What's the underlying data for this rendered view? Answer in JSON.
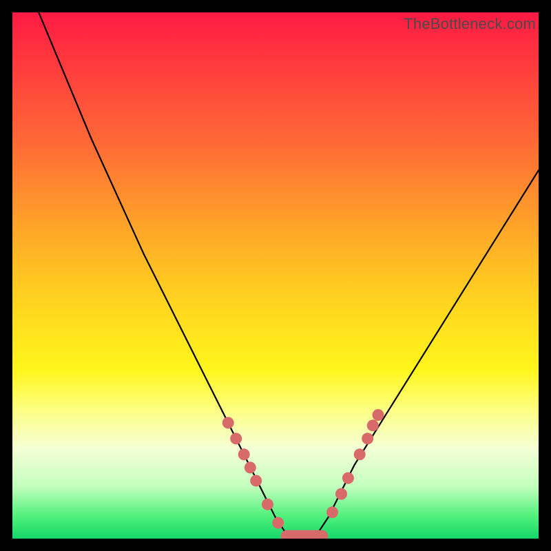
{
  "watermark": "TheBottleneck.com",
  "chart_data": {
    "type": "line",
    "title": "",
    "xlabel": "",
    "ylabel": "",
    "xlim": [
      0,
      100
    ],
    "ylim": [
      0,
      100
    ],
    "series": [
      {
        "name": "bottleneck-curve",
        "x": [
          5,
          10,
          15,
          20,
          25,
          30,
          35,
          40,
          42,
          44,
          46,
          48,
          50,
          52,
          54,
          56,
          58,
          60,
          62,
          65,
          70,
          75,
          80,
          85,
          90,
          95,
          100
        ],
        "values": [
          100,
          88,
          76,
          65,
          54,
          44,
          34,
          24,
          20,
          16,
          12,
          8,
          4,
          1,
          0,
          0,
          1,
          4,
          8,
          14,
          22,
          30,
          38,
          46,
          54,
          62,
          70
        ]
      }
    ],
    "markers": {
      "name": "highlight-dots",
      "color": "#d86a6a",
      "points": [
        {
          "x": 41.0,
          "y": 22
        },
        {
          "x": 42.5,
          "y": 19
        },
        {
          "x": 44.0,
          "y": 16
        },
        {
          "x": 45.2,
          "y": 13.5
        },
        {
          "x": 46.3,
          "y": 11
        },
        {
          "x": 48.5,
          "y": 6.5
        },
        {
          "x": 50.5,
          "y": 3
        },
        {
          "x": 60.8,
          "y": 5
        },
        {
          "x": 62.5,
          "y": 8.5
        },
        {
          "x": 63.8,
          "y": 11.5
        },
        {
          "x": 66.0,
          "y": 16
        },
        {
          "x": 67.5,
          "y": 19
        },
        {
          "x": 68.5,
          "y": 21.5
        },
        {
          "x": 69.5,
          "y": 23.5
        }
      ]
    },
    "bar_segment": {
      "name": "valley-bar",
      "color": "#d86a6a",
      "x_start": 51,
      "x_end": 60,
      "y": 0.5,
      "thickness": 2.2
    }
  }
}
